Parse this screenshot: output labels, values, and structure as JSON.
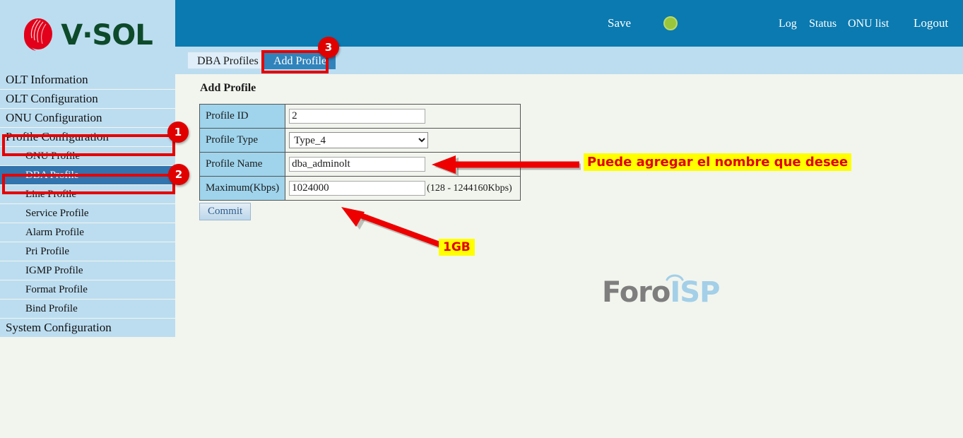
{
  "brand": {
    "logo_text": "V·SOL",
    "logo_icon": "vsol-rose-logo"
  },
  "header": {
    "save_label": "Save",
    "status_indicator": "green-status-dot",
    "links": [
      {
        "label": "Log"
      },
      {
        "label": "Status"
      },
      {
        "label": "ONU list"
      },
      {
        "label": "Logout"
      }
    ]
  },
  "tabs": [
    {
      "label": "DBA Profiles",
      "active": false
    },
    {
      "label": "Add Profile",
      "active": true
    }
  ],
  "sidebar": {
    "items": [
      {
        "label": "OLT Information",
        "level": "top",
        "selected": false
      },
      {
        "label": "OLT Configuration",
        "level": "top",
        "selected": false
      },
      {
        "label": "ONU Configuration",
        "level": "top",
        "selected": false
      },
      {
        "label": "Profile Configuration",
        "level": "top",
        "selected": false
      },
      {
        "label": "ONU Profile",
        "level": "sub",
        "selected": false
      },
      {
        "label": "DBA Profile",
        "level": "sub",
        "selected": true
      },
      {
        "label": "Line Profile",
        "level": "sub",
        "selected": false
      },
      {
        "label": "Service Profile",
        "level": "sub",
        "selected": false
      },
      {
        "label": "Alarm Profile",
        "level": "sub",
        "selected": false
      },
      {
        "label": "Pri Profile",
        "level": "sub",
        "selected": false
      },
      {
        "label": "IGMP Profile",
        "level": "sub",
        "selected": false
      },
      {
        "label": "Format Profile",
        "level": "sub",
        "selected": false
      },
      {
        "label": "Bind Profile",
        "level": "sub",
        "selected": false
      },
      {
        "label": "System Configuration",
        "level": "top",
        "selected": false
      }
    ]
  },
  "main": {
    "page_title": "Add Profile",
    "form": {
      "profile_id": {
        "label": "Profile ID",
        "value": "2"
      },
      "profile_type": {
        "label": "Profile Type",
        "value": "Type_4"
      },
      "profile_name": {
        "label": "Profile Name",
        "value": "dba_adminolt"
      },
      "maximum": {
        "label": "Maximum(Kbps)",
        "value": "1024000",
        "hint": "(128 - 1244160Kbps)"
      }
    },
    "commit_label": "Commit"
  },
  "watermark": {
    "part1": "Foro",
    "part2": "ISP"
  },
  "annotations": {
    "badge_1": "1",
    "badge_2": "2",
    "badge_3": "3",
    "note_profile_name": "Puede agregar el nombre que desee",
    "note_commit": "1GB"
  },
  "colors": {
    "header_blue": "#0a7ab0",
    "sidebar_blue": "#bcddf0",
    "selected_blue": "#3274ad",
    "tab_active_blue": "#3183bb",
    "content_bg": "#f2f5ee",
    "label_cell": "#9fd4ec",
    "annotation_red": "#e00000",
    "note_yellow": "#ffff00",
    "status_green": "#9ac63c",
    "logo_green": "#0d4a2a",
    "logo_red": "#e2001a"
  }
}
